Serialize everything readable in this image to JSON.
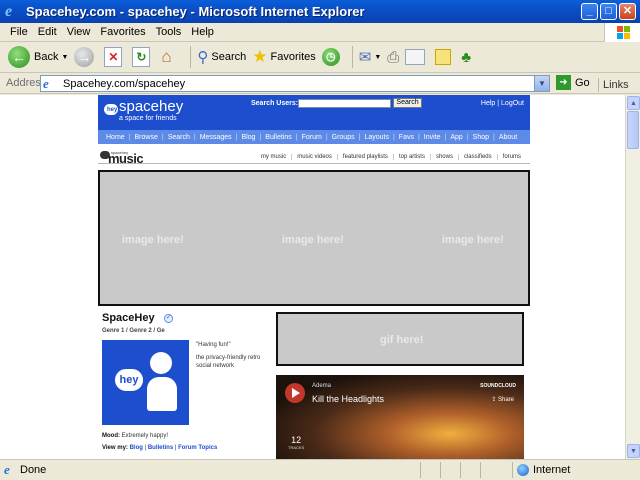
{
  "window": {
    "title": "Spacehey.com - spacehey - Microsoft Internet Explorer",
    "buttons": [
      "_",
      "□",
      "✕"
    ]
  },
  "menu": [
    "File",
    "Edit",
    "View",
    "Favorites",
    "Tools",
    "Help"
  ],
  "toolbar": {
    "back": "Back",
    "search": "Search",
    "favorites": "Favorites"
  },
  "address": {
    "label": "Address",
    "url": "Spacehey.com/spacehey",
    "go": "Go",
    "links": "Links"
  },
  "site": {
    "logo": "spacehey",
    "tagline": "a space for friends",
    "search_label": "Search Users:",
    "search_button": "Search",
    "top_links": "Help | LogOut",
    "nav": [
      "Home",
      "Browse",
      "Search",
      "Messages",
      "Blog",
      "Bulletins",
      "Forum",
      "Groups",
      "Layouts",
      "Favs",
      "Invite",
      "App",
      "Shop",
      "About"
    ]
  },
  "music": {
    "logo_prefix": "spacehey",
    "logo": "music",
    "links": [
      "my music",
      "music videos",
      "featured playlists",
      "top artists",
      "shows",
      "classifieds",
      "forums"
    ]
  },
  "banner": {
    "placeholders": [
      "image here!",
      "image here!",
      "image here!"
    ]
  },
  "profile": {
    "name": "SpaceHey",
    "genres": "Genre 1 / Genre 2 / Ge",
    "avatar_text": "hey",
    "quote": "\"Having fun!\"",
    "description": "the privacy-friendly retro social network",
    "mood_label": "Mood:",
    "mood": "Extremely happy!",
    "view_label": "View my:",
    "view_links": [
      "Blog",
      "Bulletins",
      "Forum Topics"
    ]
  },
  "gif": {
    "placeholder": "gif here!"
  },
  "soundcloud": {
    "artist": "Adema",
    "track": "Kill the Headlights",
    "brand": "SOUNDCLOUD",
    "share": "Share",
    "tracks_count": "12",
    "tracks_label": "TRACKS"
  },
  "status": {
    "text": "Done",
    "zone": "Internet"
  }
}
